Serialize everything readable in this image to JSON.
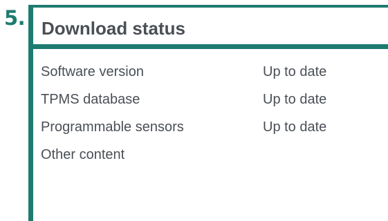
{
  "step": {
    "number": "5."
  },
  "panel": {
    "title": "Download status",
    "items": [
      {
        "label": "Software version",
        "value": "Up to date"
      },
      {
        "label": "TPMS database",
        "value": "Up to date"
      },
      {
        "label": "Programmable sensors",
        "value": "Up to date"
      },
      {
        "label": "Other content",
        "value": ""
      }
    ]
  },
  "colors": {
    "accent": "#1e7b70",
    "text": "#4a4f55",
    "background": "#ffffff"
  }
}
